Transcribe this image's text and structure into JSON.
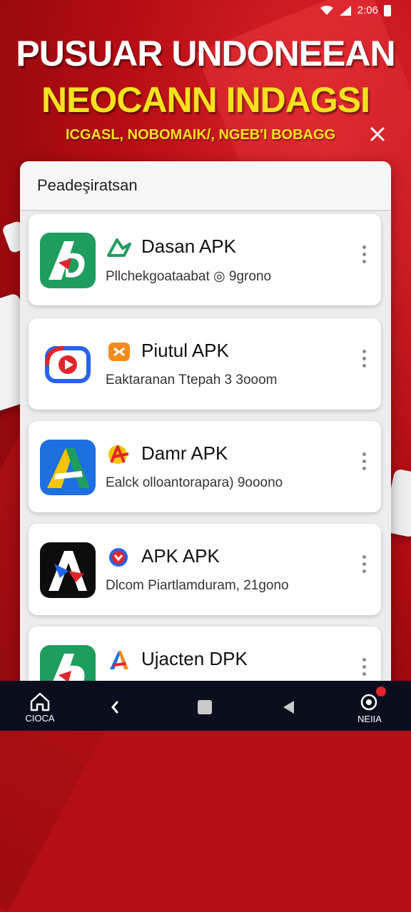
{
  "status_bar": {
    "time": "2:06",
    "icons": [
      "wifi-icon",
      "signal-icon",
      "battery-icon"
    ]
  },
  "hero": {
    "title_line1": "PUSUAR UNDONEEAN",
    "title_line2": "NEOCANN INDAGSI",
    "subtitle": "ICGASL, NOBOMAIK/, NGEB'I BOBAGG",
    "close_icon": "close-icon"
  },
  "panel": {
    "title": "Peadeşiratsan",
    "items": [
      {
        "name": "Dasan APK",
        "desc": "Pllchekgoataabat ◎ 9grono",
        "badge": "green-arrow-icon",
        "icon": "app-logo-green"
      },
      {
        "name": "Piutul APK",
        "desc": "Eaktaranan  Ttepah 3 3ooom",
        "badge": "orange-square-icon",
        "icon": "app-logo-play"
      },
      {
        "name": "Damr APK",
        "desc": "Ealck olloantorapara) 9ooono",
        "badge": "red-a-icon",
        "icon": "app-logo-blue-a"
      },
      {
        "name": "APK APK",
        "desc": "Dlcom Piartlamduram, 21gono",
        "badge": "red-blue-circle-icon",
        "icon": "app-logo-black-a"
      },
      {
        "name": "Ujacten DPK",
        "desc": "",
        "badge": "colorful-a-icon",
        "icon": "app-logo-green"
      }
    ]
  },
  "nav": {
    "home_label": "CIOCA",
    "menu_label": "NEIIA",
    "colors": {
      "bar": "#0b0f1d",
      "notification": "#e0252c"
    }
  },
  "colors": {
    "brand_red": "#c8141a",
    "headline_yellow": "#f5e21f"
  }
}
